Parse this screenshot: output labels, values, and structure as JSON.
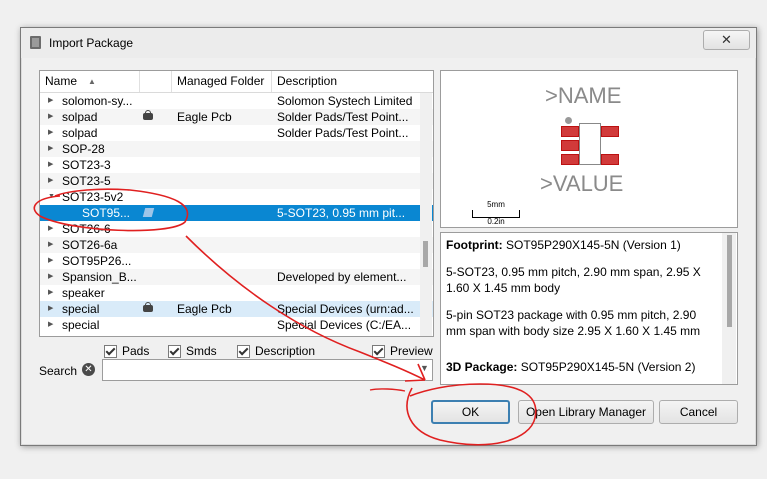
{
  "window": {
    "title": "Import Package",
    "close_glyph": "✕"
  },
  "tree": {
    "columns": [
      "Name",
      "Managed Folder",
      "Description"
    ],
    "rows": [
      {
        "name": "solomon-sy...",
        "folder": "",
        "desc": "Solomon Systech Limited",
        "expander": "▶",
        "icon": ""
      },
      {
        "name": "solpad",
        "folder": "Eagle Pcb",
        "desc": "Solder Pads/Test Point...",
        "expander": "▶",
        "icon": "lock-icon"
      },
      {
        "name": "solpad",
        "folder": "",
        "desc": "Solder Pads/Test Point...",
        "expander": "▶",
        "icon": ""
      },
      {
        "name": "SOP-28",
        "folder": "",
        "desc": "",
        "expander": "▶",
        "icon": ""
      },
      {
        "name": "SOT23-3",
        "folder": "",
        "desc": "",
        "expander": "▶",
        "icon": ""
      },
      {
        "name": "SOT23-5",
        "folder": "",
        "desc": "",
        "expander": "▶",
        "icon": ""
      },
      {
        "name": "SOT23-5v2",
        "folder": "",
        "desc": "",
        "expander": "▼",
        "icon": ""
      },
      {
        "name": "SOT95...",
        "folder": "",
        "desc": "5-SOT23, 0.95 mm pit...",
        "expander": "",
        "icon": "package-icon",
        "selected": true
      },
      {
        "name": "SOT26-6",
        "folder": "",
        "desc": "",
        "expander": "▶",
        "icon": ""
      },
      {
        "name": "SOT26-6a",
        "folder": "",
        "desc": "",
        "expander": "▶",
        "icon": ""
      },
      {
        "name": "SOT95P26...",
        "folder": "",
        "desc": "",
        "expander": "▶",
        "icon": ""
      },
      {
        "name": "Spansion_B...",
        "folder": "",
        "desc": "Developed by element...",
        "expander": "▶",
        "icon": ""
      },
      {
        "name": "speaker",
        "folder": "",
        "desc": "",
        "expander": "▶",
        "icon": ""
      },
      {
        "name": "special",
        "folder": "Eagle Pcb",
        "desc": "Special Devices (urn:ad...",
        "expander": "▶",
        "icon": "lock-icon",
        "highlight": true
      },
      {
        "name": "special",
        "folder": "",
        "desc": "Special Devices (C:/EA...",
        "expander": "▶",
        "icon": ""
      }
    ]
  },
  "preview": {
    "name": ">NAME",
    "value": ">VALUE",
    "scale_top": "5mm",
    "scale_bottom": "0.2in"
  },
  "info": {
    "footprint_label": "Footprint:",
    "footprint_value": "SOT95P290X145-5N (Version 1)",
    "summary": "5-SOT23, 0.95 mm pitch, 2.90 mm span, 2.95 X 1.60 X 1.45 mm body",
    "detail": "5-pin SOT23 package with 0.95 mm pitch, 2.90 mm span with body size 2.95 X 1.60 X 1.45 mm",
    "package3d_label": "3D Package:",
    "package3d_value": "SOT95P290X145-5N (Version 2)"
  },
  "filters": {
    "pads": "Pads",
    "smds": "Smds",
    "description": "Description",
    "preview": "Preview"
  },
  "search": {
    "label": "Search",
    "value": "",
    "placeholder": "",
    "dropdown_glyph": "▼",
    "clear_glyph": "✕"
  },
  "buttons": {
    "ok": "OK",
    "open_library_manager": "Open Library Manager",
    "cancel": "Cancel"
  },
  "colors": {
    "selection": "#0a87d2",
    "annotation": "#e02020",
    "pad": "#d13a3a"
  }
}
